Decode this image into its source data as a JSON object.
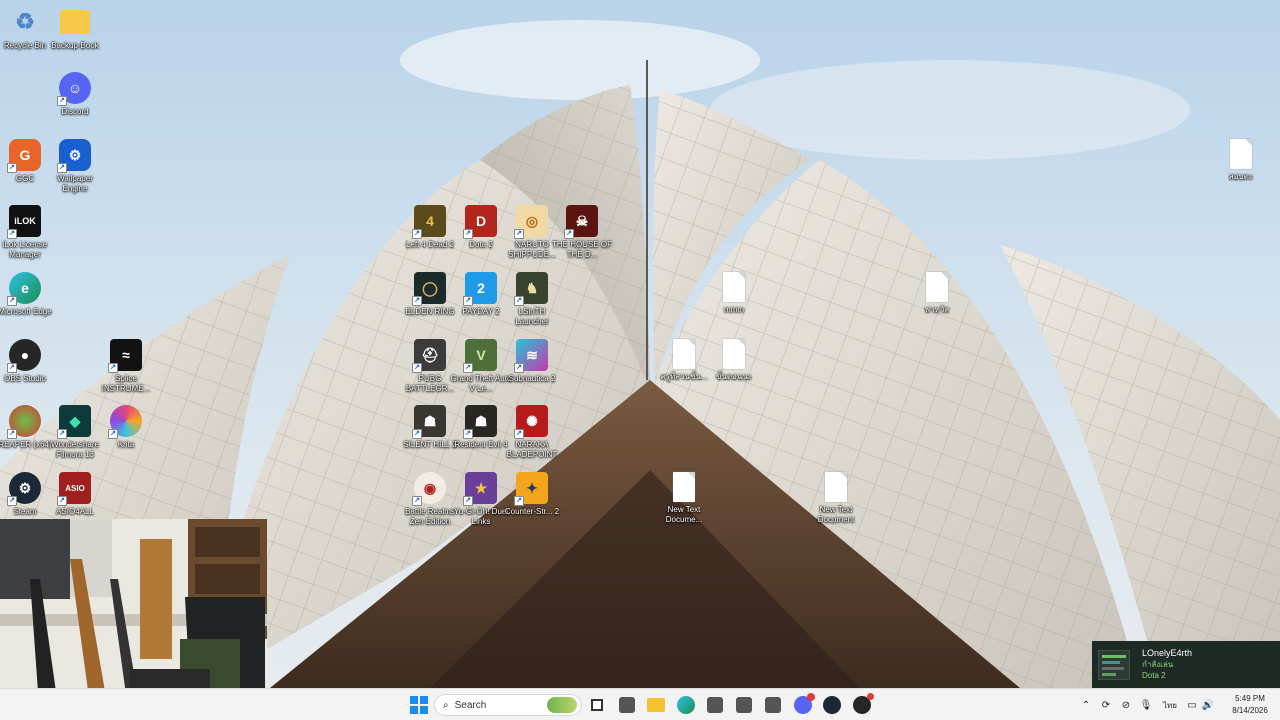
{
  "desktop": {
    "left_column": [
      {
        "label": "Recycle Bin",
        "icon": "recycle-bin-icon"
      },
      {
        "label": "Backup-Book",
        "icon": "folder-icon"
      },
      {
        "label": "Discord",
        "icon": "discord-icon"
      },
      {
        "label": "GGC",
        "icon": "ggc-icon"
      },
      {
        "label": "Wallpaper Engine",
        "icon": "wallpaper-engine-icon"
      },
      {
        "label": "iLok License Manager",
        "icon": "ilok-icon"
      },
      {
        "label": "Microsoft Edge",
        "icon": "edge-icon"
      },
      {
        "label": "OBS Studio",
        "icon": "obs-icon"
      },
      {
        "label": "Splice INSTRUME...",
        "icon": "splice-icon"
      },
      {
        "label": "REAPER (x64)",
        "icon": "reaper-icon"
      },
      {
        "label": "Wondershare Filmora 13",
        "icon": "filmora-icon"
      },
      {
        "label": "Krita",
        "icon": "krita-icon"
      },
      {
        "label": "Steam",
        "icon": "steam-icon"
      },
      {
        "label": "ASIO4ALL",
        "icon": "asio4all-icon"
      }
    ],
    "game_icons": [
      {
        "label": "Left 4 Dead 2",
        "icon": "left4dead2-icon"
      },
      {
        "label": "Dota 2",
        "icon": "dota2-icon"
      },
      {
        "label": "NARUTO SHIPPUDE...",
        "icon": "naruto-icon"
      },
      {
        "label": "THE HOUSE OF THE D...",
        "icon": "house-of-the-dead-icon"
      },
      {
        "label": "ELDEN RING",
        "icon": "elden-ring-icon"
      },
      {
        "label": "PAYDAY 2",
        "icon": "payday2-icon"
      },
      {
        "label": "LSinTH Launcher",
        "icon": "lsinth-icon"
      },
      {
        "label": "PUBG BATTLEGR...",
        "icon": "pubg-icon"
      },
      {
        "label": "Grand Theft Auto V Le...",
        "icon": "gta5-icon"
      },
      {
        "label": "Subnautica 2",
        "icon": "subnautica-icon"
      },
      {
        "label": "SILENT HILL 2",
        "icon": "silent-hill-icon"
      },
      {
        "label": "Resident Evil 4",
        "icon": "resident-evil-icon"
      },
      {
        "label": "NARAKA BLADEPOINT",
        "icon": "naraka-icon"
      },
      {
        "label": "Battle Realms Zen Edition",
        "icon": "battle-realms-icon"
      },
      {
        "label": "Yu-Gi-Oh! Duel Links",
        "icon": "yugioh-icon"
      },
      {
        "label": "Counter-Str... 2",
        "icon": "cs2-icon"
      }
    ],
    "files": [
      {
        "label": "mmm"
      },
      {
        "label": "พาทวัส"
      },
      {
        "label": "ครูที่สวนชั้น..."
      },
      {
        "label": "ขั้นตอนนะ"
      },
      {
        "label": "New Text Docume..."
      },
      {
        "label": "New Text Document"
      },
      {
        "label": "สอบตะ"
      }
    ]
  },
  "taskbar": {
    "search_placeholder": "Search",
    "apps": [
      "start-icon",
      "search-icon",
      "task-view-icon",
      "widgets-icon",
      "file-explorer-icon",
      "edge-icon",
      "app-icon",
      "app-icon",
      "app-icon",
      "discord-icon",
      "steam-icon",
      "obs-icon"
    ],
    "tray": {
      "language": "ไทย"
    },
    "time": "5:49 PM",
    "date": "8/14/2026"
  },
  "toast": {
    "user": "LOnelyE4rth",
    "status": "กำลังเล่น",
    "game": "Dota 2"
  },
  "colors": {
    "taskbar_bg": "#f3f3f3",
    "toast_bg": "#1d2b24",
    "toast_accent": "#8fd27a"
  }
}
